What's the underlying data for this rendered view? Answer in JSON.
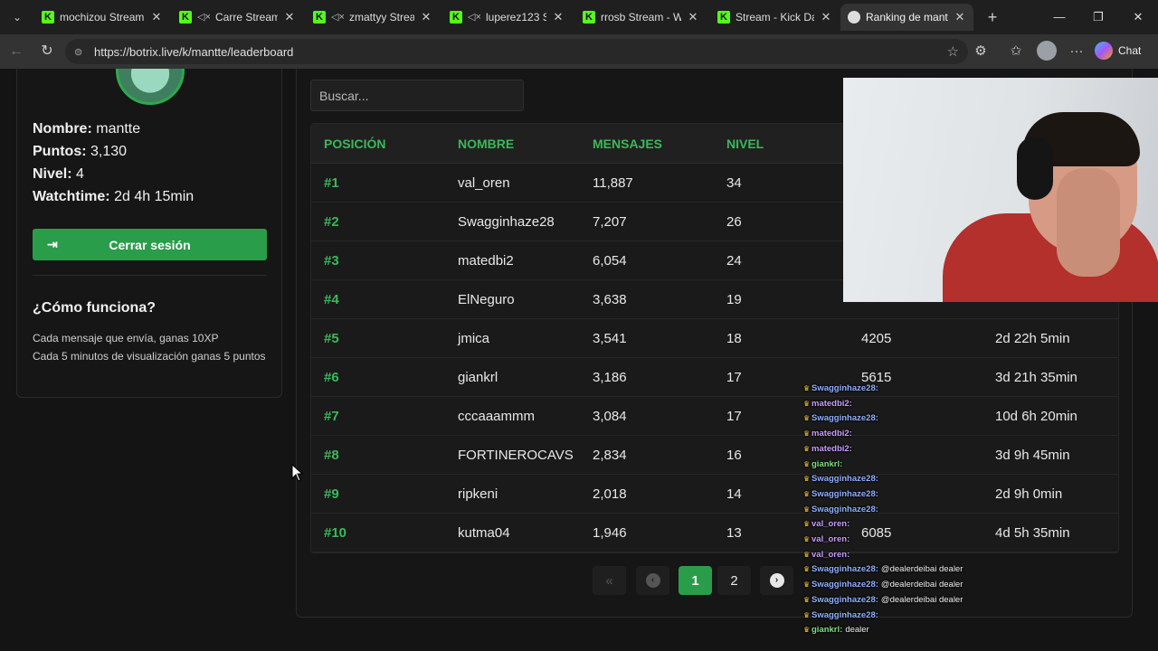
{
  "browser": {
    "tabs": [
      {
        "title": "mochizou Stream -",
        "muted": false,
        "active": false
      },
      {
        "title": "Carre Stream -",
        "muted": true,
        "active": false
      },
      {
        "title": "zmattyy Stream",
        "muted": true,
        "active": false
      },
      {
        "title": "luperez123 Str",
        "muted": true,
        "active": false
      },
      {
        "title": "rrosb Stream - Wa",
        "muted": false,
        "active": false
      },
      {
        "title": "Stream - Kick Dash",
        "muted": false,
        "active": false
      },
      {
        "title": "Ranking de mantte",
        "muted": false,
        "active": true
      }
    ],
    "url": "https://botrix.live/k/mantte/leaderboard",
    "chat_label": "Chat"
  },
  "profile": {
    "name_label": "Nombre:",
    "name_value": "mantte",
    "points_label": "Puntos:",
    "points_value": "3,130",
    "level_label": "Nivel:",
    "level_value": "4",
    "watch_label": "Watchtime:",
    "watch_value": "2d 4h 15min",
    "logout_label": "Cerrar sesión",
    "how_title": "¿Cómo funciona?",
    "how_line1": "Cada mensaje que envía, ganas 10XP",
    "how_line2": "Cada 5 minutos de visualización ganas 5 puntos"
  },
  "search": {
    "placeholder": "Buscar..."
  },
  "table": {
    "headers": [
      "POSICIÓN",
      "NOMBRE",
      "MENSAJES",
      "NIVEL"
    ],
    "rows": [
      {
        "pos": "#1",
        "name": "val_oren",
        "messages": "11,887",
        "level": "34",
        "points": "",
        "watchtime": ""
      },
      {
        "pos": "#2",
        "name": "Swagginhaze28",
        "messages": "7,207",
        "level": "26",
        "points": "",
        "watchtime": ""
      },
      {
        "pos": "#3",
        "name": "matedbi2",
        "messages": "6,054",
        "level": "24",
        "points": "",
        "watchtime": ""
      },
      {
        "pos": "#4",
        "name": "ElNeguro",
        "messages": "3,638",
        "level": "19",
        "points": "",
        "watchtime": ""
      },
      {
        "pos": "#5",
        "name": "jmica",
        "messages": "3,541",
        "level": "18",
        "points": "4205",
        "watchtime": "2d 22h 5min"
      },
      {
        "pos": "#6",
        "name": "giankrl",
        "messages": "3,186",
        "level": "17",
        "points": "5615",
        "watchtime": "3d 21h 35min"
      },
      {
        "pos": "#7",
        "name": "cccaaammm",
        "messages": "3,084",
        "level": "17",
        "points": "",
        "watchtime": "10d 6h 20min"
      },
      {
        "pos": "#8",
        "name": "FORTINEROCAVS",
        "messages": "2,834",
        "level": "16",
        "points": "",
        "watchtime": "3d 9h 45min"
      },
      {
        "pos": "#9",
        "name": "ripkeni",
        "messages": "2,018",
        "level": "14",
        "points": "",
        "watchtime": "2d 9h 0min"
      },
      {
        "pos": "#10",
        "name": "kutma04",
        "messages": "1,946",
        "level": "13",
        "points": "6085",
        "watchtime": "4d 5h 35min"
      }
    ]
  },
  "pagination": {
    "first": "«",
    "pages": [
      "1",
      "2"
    ],
    "current": "1",
    "next": "›"
  },
  "chat_overlay": [
    {
      "name": "Swagginhaze28:",
      "text": "",
      "color": "#8fb0ff"
    },
    {
      "name": "matedbi2:",
      "text": "",
      "color": "#c89cff"
    },
    {
      "name": "Swagginhaze28:",
      "text": "",
      "color": "#8fb0ff"
    },
    {
      "name": "matedbi2:",
      "text": "",
      "color": "#c89cff"
    },
    {
      "name": "matedbi2:",
      "text": "",
      "color": "#c89cff"
    },
    {
      "name": "giankrl:",
      "text": "",
      "color": "#7ee07e"
    },
    {
      "name": "Swagginhaze28:",
      "text": "",
      "color": "#8fb0ff"
    },
    {
      "name": "Swagginhaze28:",
      "text": "",
      "color": "#8fb0ff"
    },
    {
      "name": "Swagginhaze28:",
      "text": "",
      "color": "#8fb0ff"
    },
    {
      "name": "val_oren:",
      "text": "",
      "color": "#c89cff"
    },
    {
      "name": "val_oren:",
      "text": "",
      "color": "#c89cff"
    },
    {
      "name": "val_oren:",
      "text": "",
      "color": "#c89cff"
    },
    {
      "name": "Swagginhaze28:",
      "text": "@dealerdeibai dealer",
      "color": "#8fb0ff"
    },
    {
      "name": "Swagginhaze28:",
      "text": "@dealerdeibai dealer",
      "color": "#8fb0ff"
    },
    {
      "name": "Swagginhaze28:",
      "text": "@dealerdeibai dealer",
      "color": "#8fb0ff"
    },
    {
      "name": "Swagginhaze28:",
      "text": "",
      "color": "#8fb0ff"
    },
    {
      "name": "giankrl:",
      "text": "dealer",
      "color": "#7ee07e"
    }
  ],
  "colors": {
    "accent": "#2a9d4a",
    "accent_text": "#3bb85a",
    "background": "#141414"
  }
}
